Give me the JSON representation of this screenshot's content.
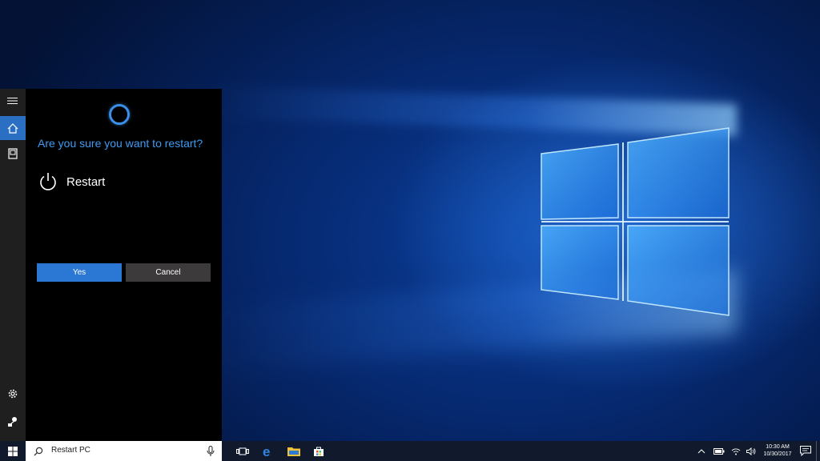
{
  "cortana": {
    "question": "Are you sure you want to restart?",
    "action_label": "Restart",
    "yes_label": "Yes",
    "cancel_label": "Cancel"
  },
  "rail": {
    "items": [
      {
        "icon": "hamburger-icon"
      },
      {
        "icon": "home-icon",
        "active": true
      },
      {
        "icon": "notebook-icon"
      },
      {
        "icon": "settings-icon"
      },
      {
        "icon": "feedback-icon"
      }
    ]
  },
  "taskbar": {
    "search_value": "Restart PC",
    "time": "10:30 AM",
    "date": "10/30/2017",
    "pinned": [
      "task-view-icon",
      "edge-icon",
      "file-explorer-icon",
      "store-icon"
    ],
    "tray": [
      "chevron-up-icon",
      "battery-icon",
      "wifi-icon",
      "volume-icon",
      "notification-icon"
    ]
  },
  "colors": {
    "accent": "#2a78d4",
    "question_text": "#3f9af2",
    "panel_bg": "#000000",
    "taskbar_bg": "#101a2c"
  }
}
